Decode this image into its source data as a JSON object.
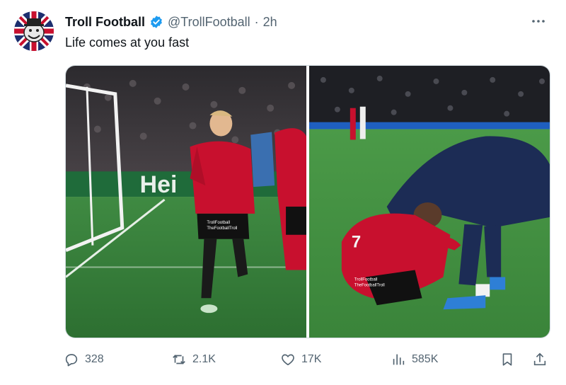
{
  "tweet": {
    "display_name": "Troll Football",
    "handle": "@TrollFootball",
    "separator": "·",
    "timestamp": "2h",
    "text": "Life comes at you fast",
    "verified": true,
    "more_icon": "more-horizontal-icon"
  },
  "media": {
    "left_watermark_1": "TrollFootball",
    "left_watermark_2": "TheFootballTroll",
    "right_watermark_1": "TrollFootball",
    "right_watermark_2": "TheFootballTroll",
    "left_board_text": "Hei"
  },
  "actions": {
    "replies": "328",
    "reposts": "2.1K",
    "likes": "17K",
    "views": "585K"
  },
  "colors": {
    "verified_blue": "#1d9bf0",
    "icon_grey": "#536471",
    "text_dark": "#0f1419",
    "pitch_green": "#2f7d3a",
    "kit_red": "#c8102e"
  }
}
